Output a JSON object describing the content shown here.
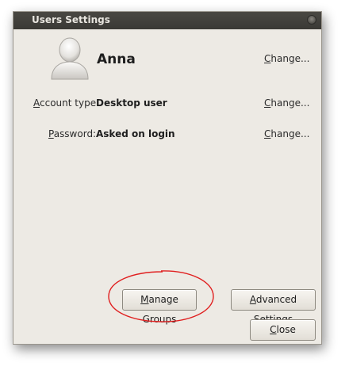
{
  "window": {
    "title": "Users Settings"
  },
  "user": {
    "name": "Anna",
    "avatar_icon": "user-avatar-icon",
    "change_name_label": "Change..."
  },
  "account_type": {
    "label": "Account type:",
    "value": "Desktop user",
    "change_label": "Change..."
  },
  "password": {
    "label": "Password:",
    "value": "Asked on login",
    "change_label": "Change..."
  },
  "buttons": {
    "manage_groups": "Manage Groups",
    "advanced_settings": "Advanced Settings",
    "close": "Close"
  },
  "colors": {
    "window_bg": "#edeae4",
    "titlebar_bg": "#3c3b37",
    "highlight_ellipse": "#e02020"
  }
}
